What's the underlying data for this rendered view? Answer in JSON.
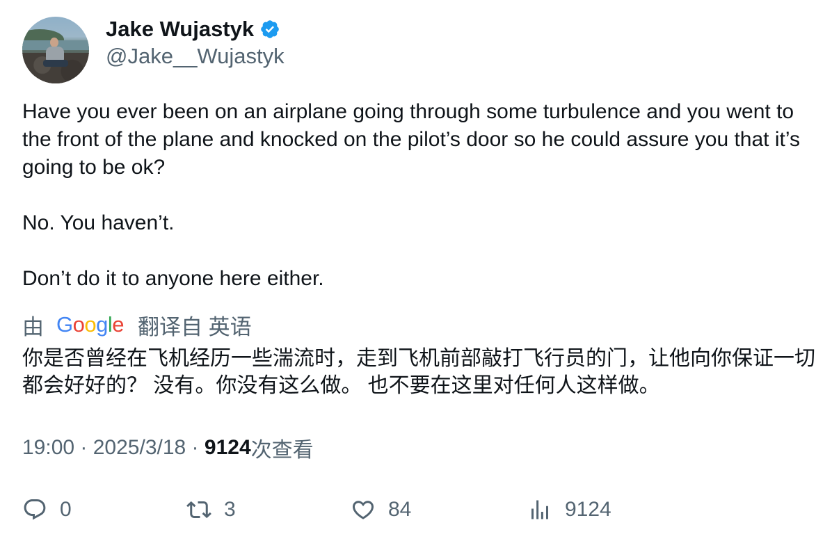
{
  "author": {
    "display_name": "Jake Wujastyk",
    "handle": "@Jake__Wujastyk",
    "verified": true,
    "verified_color": "#1d9bf0"
  },
  "tweet": {
    "paragraphs": [
      "Have you ever been on an airplane going through some turbulence and you went to the front of the plane and knocked on the pilot’s door so he could assure you that it’s going to be ok?",
      "No. You haven’t.",
      "Don’t do it to anyone here either."
    ]
  },
  "translation": {
    "prefix": "由",
    "provider": "Google",
    "suffix": "翻译自 英语",
    "text": "你是否曾经在飞机经历一些湍流时，走到飞机前部敲打飞行员的门，让他向你保证一切都会好好的？ 没有。你没有这么做。 也不要在这里对任何人这样做。"
  },
  "meta": {
    "time": "19:00",
    "separator": " · ",
    "date": "2025/3/18",
    "views_count": "9124",
    "views_label": "次查看"
  },
  "actions": {
    "replies": "0",
    "retweets": "3",
    "likes": "84",
    "views": "9124"
  },
  "icons": {
    "reply": "reply-icon",
    "retweet": "retweet-icon",
    "like": "heart-icon",
    "views": "views-icon",
    "verified": "verified-badge-icon"
  }
}
